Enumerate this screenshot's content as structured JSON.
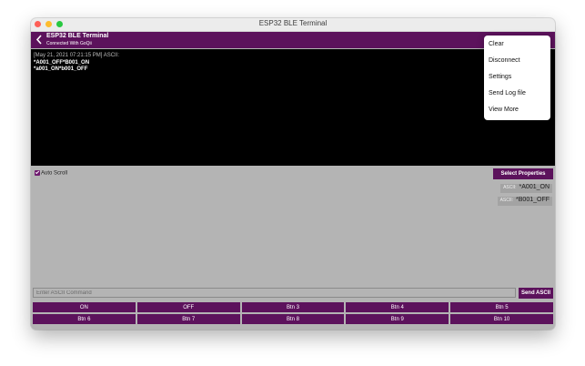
{
  "window": {
    "title": "ESP32 BLE Terminal"
  },
  "appbar": {
    "title": "ESP32 BLE Terminal",
    "subtitle": "Connected With GoQii"
  },
  "terminal": {
    "timestamp": "[May 21, 2021 07:21:15 PM] ASCII:",
    "lines": [
      "*A001_OFF*B001_ON",
      "*a001_ON*b001_OFF"
    ]
  },
  "controls": {
    "auto_scroll_label": "Auto Scroll",
    "select_properties_label": "Select Properties"
  },
  "commands": [
    {
      "tag": "ASCII:",
      "value": "*A001_ON"
    },
    {
      "tag": "ASCII:",
      "value": "*B001_OFF"
    }
  ],
  "input": {
    "placeholder": "Enter ASCII Command",
    "value": ""
  },
  "send_label": "Send ASCII",
  "buttons": [
    "ON",
    "OFF",
    "Btn 3",
    "Btn 4",
    "Btn 5",
    "Btn 6",
    "Btn 7",
    "Btn 8",
    "Btn 9",
    "Btn 10"
  ],
  "menu": {
    "items": [
      "Clear",
      "Disconnect",
      "Settings",
      "Send Log file",
      "View More"
    ]
  },
  "colors": {
    "accent": "#5c125c",
    "terminal_bg": "#000000",
    "panel_bg": "#b4b4b4"
  }
}
